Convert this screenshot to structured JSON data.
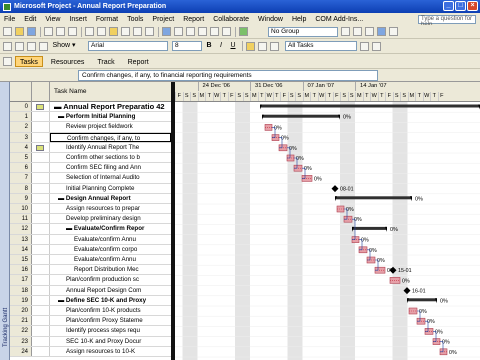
{
  "window": {
    "title": "Microsoft Project - Annual Report Preparation"
  },
  "menu": [
    "File",
    "Edit",
    "View",
    "Insert",
    "Format",
    "Tools",
    "Project",
    "Report",
    "Collaborate",
    "Window",
    "Help",
    "COM Add-Ins..."
  ],
  "help_box": {
    "placeholder": "Type a question for help"
  },
  "toolbar2": {
    "show_label": "Show ▾",
    "font": "Arial",
    "size": "8",
    "filter": "All Tasks",
    "bold": "B",
    "italic": "I",
    "underline": "U"
  },
  "toolbar1": {
    "group": "No Group"
  },
  "guide": {
    "tasks": "Tasks",
    "resources": "Resources",
    "track": "Track",
    "report": "Report"
  },
  "edit_bar": {
    "value": "Confirm changes, if any, to financial reporting requirements"
  },
  "columns": {
    "task_name": "Task Name"
  },
  "side_label": "Tracking Gantt",
  "timescale": {
    "weeks": [
      "24 Dec '06",
      "31 Dec '06",
      "07 Jan '07",
      "14 Jan '07"
    ],
    "days": [
      "F",
      "S",
      "S",
      "M",
      "T",
      "W",
      "T",
      "F",
      "S",
      "S",
      "M",
      "T",
      "W",
      "T",
      "F",
      "S",
      "S",
      "M",
      "T",
      "W",
      "T",
      "F",
      "S",
      "S",
      "M",
      "T",
      "W",
      "T",
      "F",
      "S",
      "S",
      "M",
      "T",
      "W",
      "T",
      "F"
    ]
  },
  "tasks": [
    {
      "id": "0",
      "name": "Annual Report Preparatio  42",
      "level": 0,
      "summary": true,
      "note": true
    },
    {
      "id": "1",
      "name": "Perform Initial Planning",
      "level": 1,
      "summary": true
    },
    {
      "id": "2",
      "name": "Review project fieldwork",
      "level": 2
    },
    {
      "id": "3",
      "name": "Confirm changes, if any, to",
      "level": 2,
      "selected": true
    },
    {
      "id": "4",
      "name": "Identify Annual Report The",
      "level": 2,
      "note": true
    },
    {
      "id": "5",
      "name": "Confirm other sections to b",
      "level": 2
    },
    {
      "id": "6",
      "name": "Confirm SEC filing and Ann",
      "level": 2
    },
    {
      "id": "7",
      "name": "Selection of Internal Audito",
      "level": 2
    },
    {
      "id": "8",
      "name": "Initial Planning Complete",
      "level": 2
    },
    {
      "id": "9",
      "name": "Design Annual Report",
      "level": 1,
      "summary": true
    },
    {
      "id": "10",
      "name": "Assign resources to prepar",
      "level": 2
    },
    {
      "id": "11",
      "name": "Develop preliminary design",
      "level": 2
    },
    {
      "id": "12",
      "name": "Evaluate/Confirm Repor",
      "level": 2,
      "summary": true
    },
    {
      "id": "13",
      "name": "Evaluate/confirm Annu",
      "level": 3
    },
    {
      "id": "14",
      "name": "Evaluate/confirm corpo",
      "level": 3
    },
    {
      "id": "15",
      "name": "Evaluate/confirm Annu",
      "level": 3
    },
    {
      "id": "16",
      "name": "Report Distribution Mec",
      "level": 3
    },
    {
      "id": "17",
      "name": "Plan/confirm production sc",
      "level": 2
    },
    {
      "id": "18",
      "name": "Annual Report Design Com",
      "level": 2
    },
    {
      "id": "19",
      "name": "Define SEC 10-K and Proxy",
      "level": 1,
      "summary": true
    },
    {
      "id": "20",
      "name": "Plan/confirm 10-K products",
      "level": 2
    },
    {
      "id": "21",
      "name": "Plan/confirm Proxy Stateme",
      "level": 2
    },
    {
      "id": "22",
      "name": "Identify process steps requ",
      "level": 2
    },
    {
      "id": "23",
      "name": "SEC 10-K and Proxy Docur",
      "level": 2
    },
    {
      "id": "24",
      "name": "Assign resources to 10-K",
      "level": 2
    }
  ],
  "gantt_labels": {
    "pct": "0%",
    "m8": "08-01",
    "m16": "15-01",
    "m18": "16-01"
  }
}
